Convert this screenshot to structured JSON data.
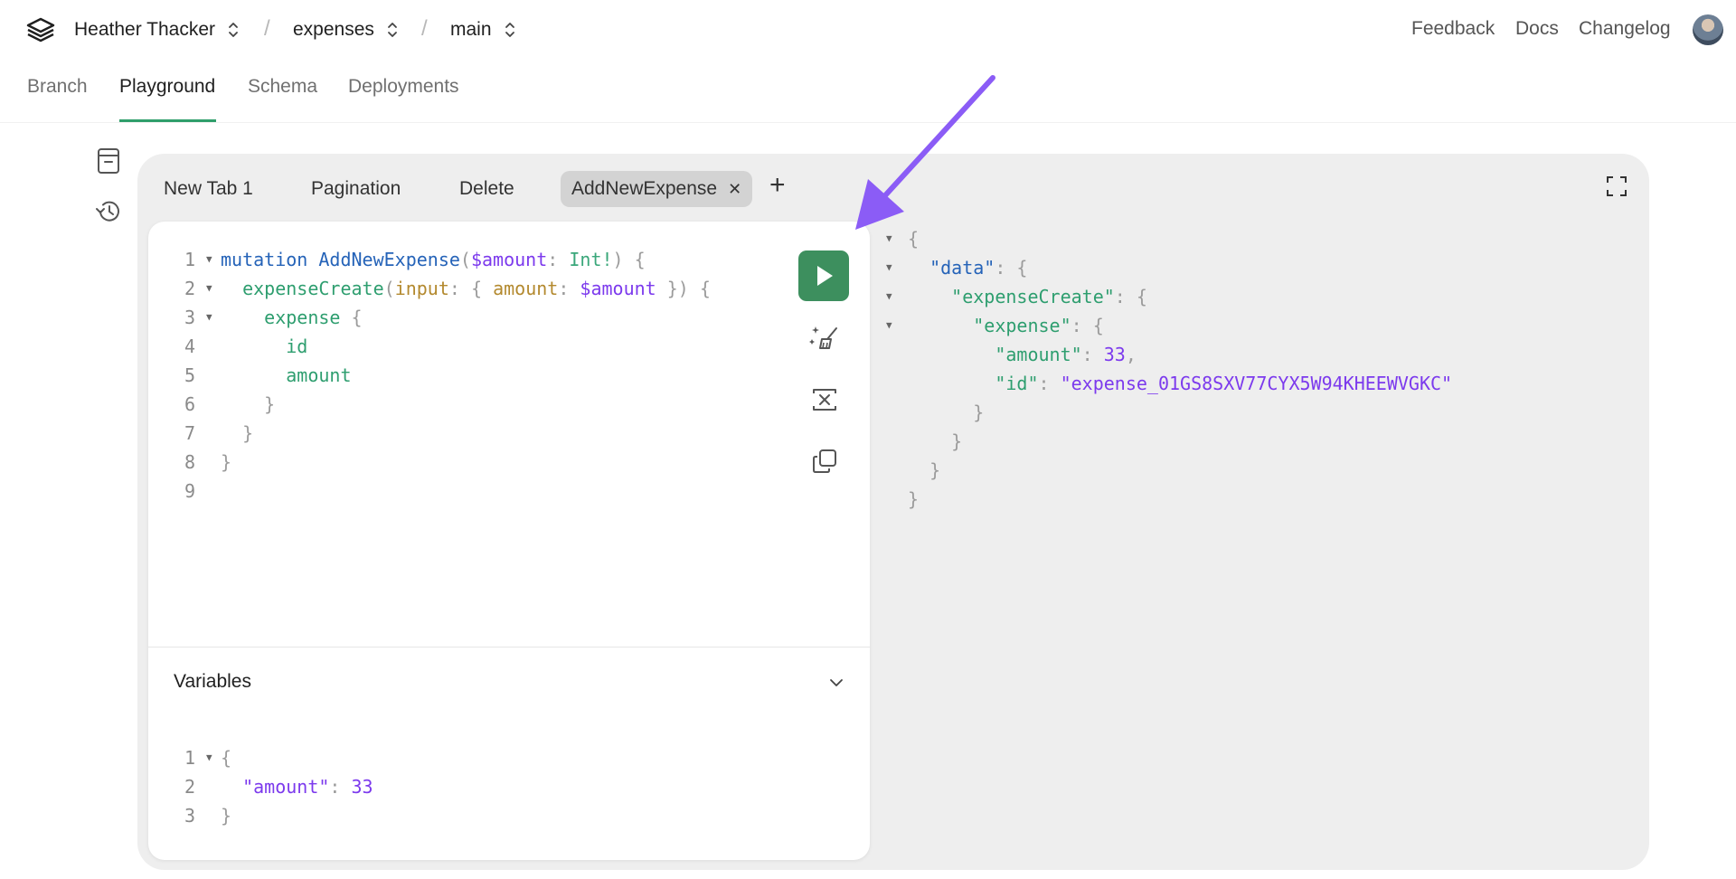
{
  "header": {
    "org": "Heather Thacker",
    "project": "expenses",
    "branch": "main",
    "links": {
      "feedback": "Feedback",
      "docs": "Docs",
      "changelog": "Changelog"
    }
  },
  "nav": {
    "branch": "Branch",
    "playground": "Playground",
    "schema": "Schema",
    "deployments": "Deployments",
    "active": "Playground"
  },
  "rail_icons": [
    "saved-queries-icon",
    "history-icon"
  ],
  "tabs": [
    {
      "label": "New Tab 1"
    },
    {
      "label": "Pagination"
    },
    {
      "label": "Delete"
    },
    {
      "label": "AddNewExpense",
      "active": true
    }
  ],
  "editor": {
    "line_numbers": [
      "1",
      "2",
      "3",
      "4",
      "5",
      "6",
      "7",
      "8",
      "9"
    ],
    "query": {
      "kw_mutation": "mutation",
      "op_name": "AddNewExpense",
      "var_amount": "$amount",
      "type_int": "Int!",
      "field_create": "expenseCreate",
      "arg_input": "input",
      "arg_amount": "amount",
      "field_expense": "expense",
      "field_id": "id",
      "field_amount": "amount"
    }
  },
  "variables": {
    "title": "Variables",
    "line_numbers": [
      "1",
      "2",
      "3"
    ],
    "key": "\"amount\"",
    "value": "33"
  },
  "result": {
    "data_key": "\"data\"",
    "create_key": "\"expenseCreate\"",
    "expense_key": "\"expense\"",
    "amount_key": "\"amount\"",
    "amount_value": "33",
    "id_key": "\"id\"",
    "id_value": "\"expense_01GS8SXV77CYX5W94KHEEWVGKC\""
  },
  "colors": {
    "accent_green": "#3d8f5e",
    "nav_underline": "#2f9e6b",
    "annotation_arrow": "#8b5cf6",
    "panel_bg": "#eeeeee"
  }
}
